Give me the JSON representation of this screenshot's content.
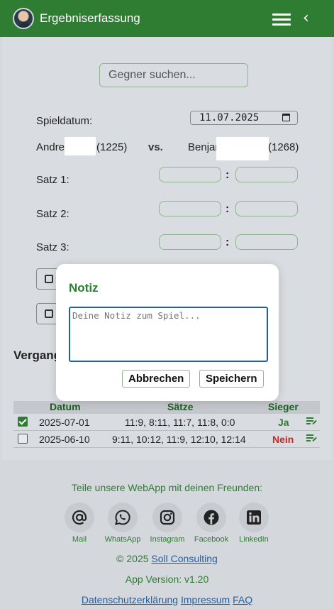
{
  "header": {
    "title": "Ergebniserfassung",
    "menu_icon": "hamburger-icon",
    "back_icon": "chevron-left-icon"
  },
  "form": {
    "search_placeholder": "Gegner suchen...",
    "date_label": "Spieldatum:",
    "date_value": "11.07.2025",
    "player1": {
      "name": "Andrea",
      "rating": "(1225)"
    },
    "vs": "vs.",
    "player2": {
      "name": "Benjar",
      "rating": "(1268)"
    },
    "sets": [
      {
        "label": "Satz 1:",
        "a": "",
        "b": ""
      },
      {
        "label": "Satz 2:",
        "a": "",
        "b": ""
      },
      {
        "label": "Satz 3:",
        "a": "",
        "b": ""
      }
    ],
    "separator": ":"
  },
  "history": {
    "title_visible": "Vergang",
    "columns": [
      "Datum",
      "Sätze",
      "Sieger"
    ],
    "rows": [
      {
        "checked": true,
        "date": "2025-07-01",
        "sets": "11:9, 8:11, 11:7, 11:8, 0:0",
        "winner": "Ja",
        "winner_color": "#2e7d32"
      },
      {
        "checked": false,
        "date": "2025-06-10",
        "sets": "9:11, 10:12, 11:9, 12:10, 12:14",
        "winner": "Nein",
        "winner_color": "#c62828"
      }
    ]
  },
  "modal": {
    "title": "Notiz",
    "note_placeholder": "Deine Notiz zum Spiel...",
    "cancel_label": "Abbrechen",
    "save_label": "Speichern"
  },
  "footer": {
    "share_text": "Teile unsere WebApp mit deinen Freunden:",
    "share_items": [
      {
        "label": "Mail",
        "icon": "at-icon"
      },
      {
        "label": "WhatsApp",
        "icon": "whatsapp-icon"
      },
      {
        "label": "Instagram",
        "icon": "instagram-icon"
      },
      {
        "label": "Facebook",
        "icon": "facebook-icon"
      },
      {
        "label": "LinkedIn",
        "icon": "linkedin-icon"
      }
    ],
    "copyright_prefix": "© 2025",
    "company": "Soll Consulting",
    "version": "App Version: v1.20",
    "links": [
      "Datenschutzerklärung",
      "Impressum",
      "FAQ"
    ]
  },
  "colors": {
    "brand": "#2e7d32",
    "link": "#1f5fa8",
    "win": "#2e7d32",
    "loss": "#c62828"
  }
}
